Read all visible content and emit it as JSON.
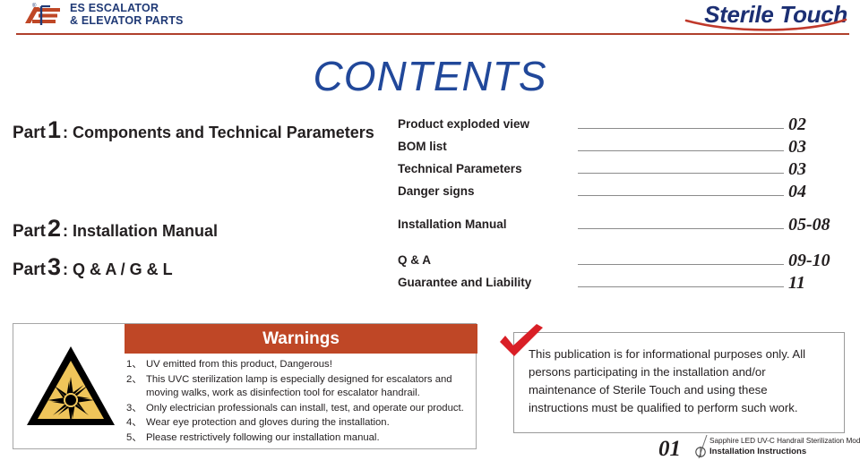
{
  "header": {
    "logo": {
      "icon": "es-logo-mark",
      "line1": "ES ESCALATOR",
      "line2": "& ELEVATOR PARTS",
      "registered_mark": "®",
      "color_blue": "#203a76",
      "color_red": "#bf4726"
    },
    "brand": {
      "name": "Sterile Touch",
      "color": "#1c2f73",
      "swoosh_color": "#c0392b"
    },
    "rule_color": "#b0402c"
  },
  "title": {
    "text": "CONTENTS",
    "color": "#21489a"
  },
  "parts": [
    {
      "word": "Part",
      "number": "1",
      "label": ": Components and Technical Parameters"
    },
    {
      "word": "Part",
      "number": "2",
      "label": ": Installation Manual"
    },
    {
      "word": "Part",
      "number": "3",
      "label": ": Q & A / G & L"
    }
  ],
  "toc": [
    {
      "label": "Product exploded view",
      "page": "02"
    },
    {
      "label": "BOM list",
      "page": "03"
    },
    {
      "label": "Technical Parameters",
      "page": "03"
    },
    {
      "label": "Danger signs",
      "page": "04"
    },
    {
      "label": "Installation Manual",
      "page": "05-08"
    },
    {
      "label": "Q & A",
      "page": "09-10"
    },
    {
      "label": "Guarantee and Liability",
      "page": "11"
    }
  ],
  "warnings": {
    "title": "Warnings",
    "header_color": "#bf4726",
    "symbol_icon": "uv-radiation-hazard-triangle-icon",
    "symbol_fill": "#efc55a",
    "items": [
      {
        "num": "1、",
        "text": "UV emitted from this product, Dangerous!"
      },
      {
        "num": "2、",
        "text": "This UVC sterilization lamp is especially designed for escalators and moving walks, work as disinfection tool for escalator handrail."
      },
      {
        "num": "3、",
        "text": "Only electrician professionals can install, test, and operate our product."
      },
      {
        "num": "4、",
        "text": "Wear eye protection and gloves during the installation."
      },
      {
        "num": "5、",
        "text": "Please restrictively following our installation manual."
      }
    ]
  },
  "notice": {
    "checkmark_icon": "red-check-icon",
    "checkmark_color": "#d91f26",
    "text": "This publication is for informational purposes only. All persons participating in the installation and/or maintenance of Sterile Touch and using these instructions must be qualified to perform such work."
  },
  "footer": {
    "page_number": "01",
    "icon": "pencil-circle-icon",
    "line1": "Sapphire LED UV-C Handrail Sterilization Module",
    "line2": "Installation Instructions"
  }
}
